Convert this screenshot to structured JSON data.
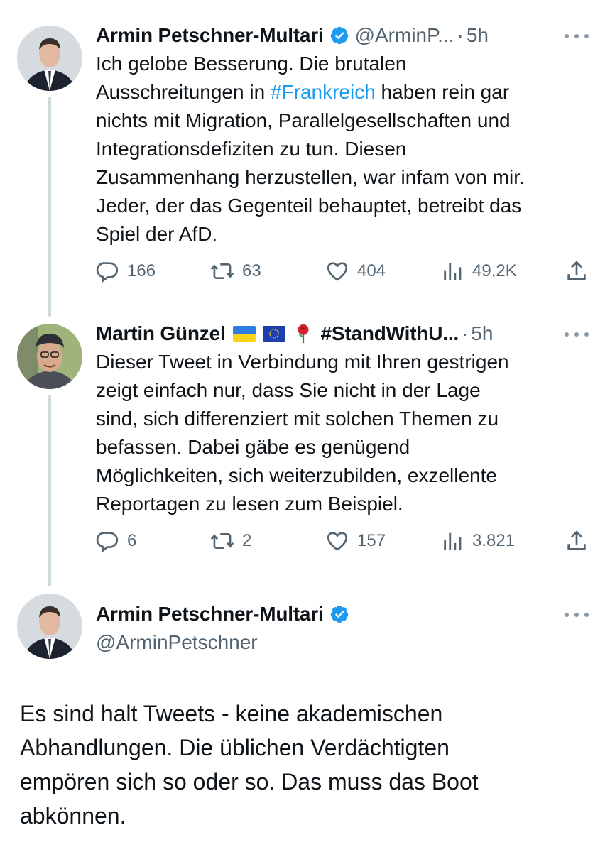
{
  "tweets": [
    {
      "author": "Armin Petschner-Multari",
      "handle": "@ArminP...",
      "separator": "·",
      "time": "5h",
      "text_before": "Ich gelobe Besserung. Die brutalen\nAusschreitungen in ",
      "hashtag": "#Frankreich",
      "text_after": " haben rein gar\nnichts mit Migration, Parallelgesellschaften und\nIntegrationsdefiziten zu tun. Diesen\nZusammenhang herzustellen, war infam von mir.\nJeder, der das Gegenteil behauptet, betreibt das\nSpiel der AfD.",
      "replies": "166",
      "reposts": "63",
      "likes": "404",
      "views": "49,2K"
    },
    {
      "author": "Martin Günzel",
      "author_tag": "#StandWithU...",
      "handle": "",
      "separator": "·",
      "time": "5h",
      "text": "Dieser Tweet in Verbindung mit Ihren gestrigen\nzeigt einfach nur, dass Sie nicht in der Lage\nsind, sich differenziert mit solchen Themen zu\nbefassen. Dabei gäbe es genügend\nMöglichkeiten, sich weiterzubilden, exzellente\nReportagen zu lesen zum Beispiel.",
      "replies": "6",
      "reposts": "2",
      "likes": "157",
      "views": "3.821"
    },
    {
      "author": "Armin Petschner-Multari",
      "handle": "@ArminPetschner",
      "text": "Es sind halt Tweets - keine akademischen\nAbhandlungen. Die üblichen Verdächtigten\nempören sich so oder so. Das muss das Boot\nabkönnen."
    }
  ],
  "icons": {
    "reply": "reply-icon",
    "repost": "repost-icon",
    "like": "heart-icon",
    "views": "views-icon",
    "share": "share-icon",
    "verified": "verified-badge-icon",
    "more": "more-icon"
  },
  "colors": {
    "accent": "#1d9bf0",
    "muted": "#536471",
    "thread_line": "#cfd9de"
  }
}
